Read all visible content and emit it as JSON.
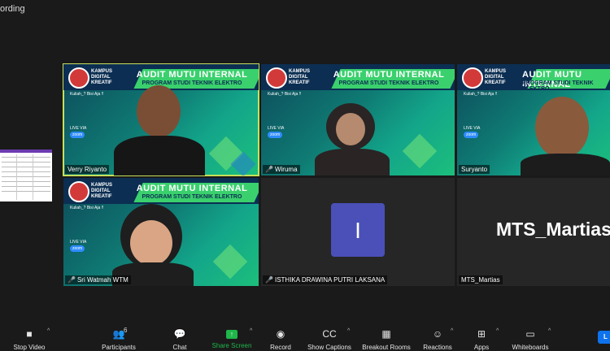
{
  "recording_label": "ording",
  "banner": {
    "title": "AUDIT MUTU INTERNAL",
    "subtitle": "PROGRAM STUDI TEKNIK ELEKTRO",
    "logo_text": "KAMPUS DIGITAL KREATIF",
    "small_text": "Kuliah_?\nBisi Aja !!",
    "live_via": "LIVE VIA",
    "zoom": "zoom"
  },
  "participants": [
    {
      "name": "Verry Riyanto",
      "muted": false
    },
    {
      "name": "Wiruma",
      "muted": true
    },
    {
      "name": "Suryanto",
      "muted": false
    },
    {
      "name": "Sri Watmah WTM",
      "muted": true
    },
    {
      "name": "ISTHIKA DRAWINA PUTRI LAKSANA",
      "muted": true,
      "avatar_letter": "I"
    },
    {
      "name": "MTS_Martias",
      "display_text": "MTS_Martias"
    }
  ],
  "toolbar": {
    "stop_video": "Stop Video",
    "participants": "Participants",
    "participants_count": "6",
    "chat": "Chat",
    "share_screen": "Share Screen",
    "record": "Record",
    "captions": "Show Captions",
    "breakout": "Breakout Rooms",
    "reactions": "Reactions",
    "apps": "Apps",
    "whiteboards": "Whiteboards",
    "leave": "L"
  },
  "colors": {
    "active_speaker": "#c6e05a",
    "share_green": "#1fb64a",
    "avatar_bg": "#4a50b8",
    "leave_blue": "#0e72ed"
  }
}
